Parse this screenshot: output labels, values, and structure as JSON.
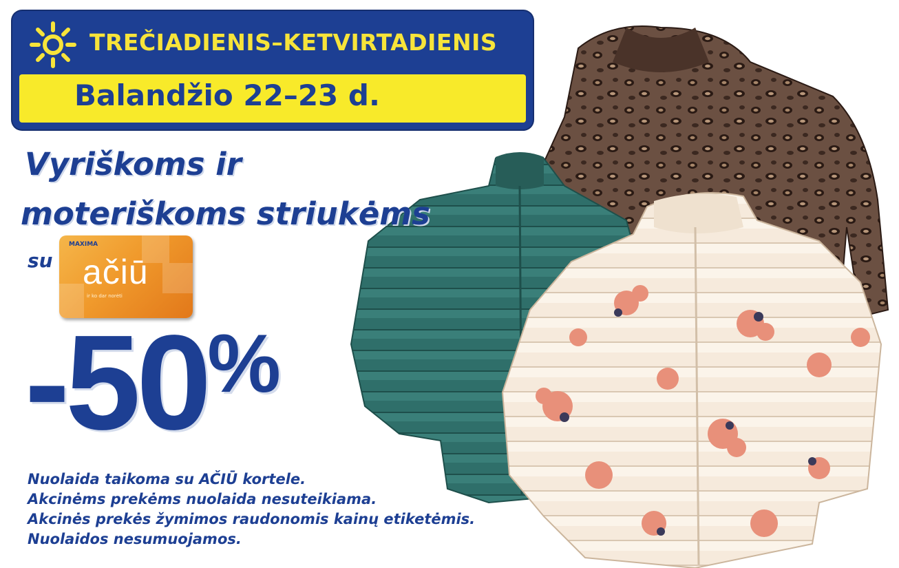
{
  "header": {
    "days": "TREČIADIENIS–KETVIRTADIENIS",
    "date": "Balandžio 22–23 d."
  },
  "headline": {
    "line1": "Vyriškoms ir",
    "line2": "moteriškoms striukėms"
  },
  "card": {
    "prefix": "su",
    "brand_small": "MAXIMA",
    "word": "ačiū",
    "sub": "ir ko dar norėti"
  },
  "discount": {
    "value": "-50",
    "unit": "%"
  },
  "notes": [
    "Nuolaida taikoma su AČIŪ kortele.",
    "Akcinėms prekėms nuolaida nesuteikiama.",
    "Akcinės prekės žymimos raudonomis kainų etiketėmis.",
    "Nuolaidos nesumuojamos."
  ],
  "colors": {
    "brand_blue": "#1d3f93",
    "brand_yellow": "#f8ea2a",
    "teal_jacket": "#2f6f6a",
    "leopard_jacket": "#5a4135",
    "floral_jacket": "#f6eadc",
    "flower_pink": "#e8907a"
  },
  "icons": [
    "sun-icon",
    "teal-jacket",
    "leopard-jacket",
    "floral-jacket"
  ]
}
